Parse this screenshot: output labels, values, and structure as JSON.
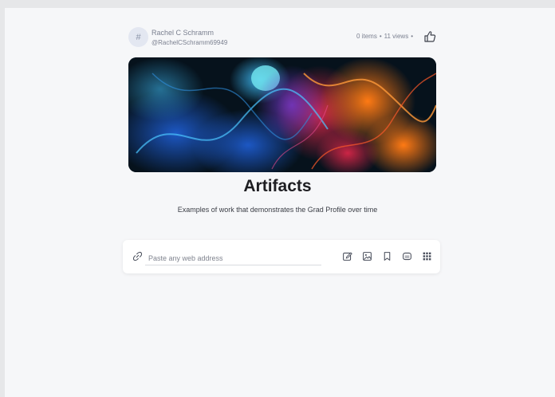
{
  "user": {
    "avatar_glyph": "#",
    "name": "Rachel C Schramm",
    "handle": "@RachelCSchramm69949"
  },
  "stats": {
    "items": "0 items",
    "views": "11 views",
    "separator": "•"
  },
  "page": {
    "title": "Artifacts",
    "subtitle": "Examples of work that demonstrates the Grad Profile over time"
  },
  "composer": {
    "placeholder": "Paste any web address",
    "value": ""
  },
  "icons": {
    "like": "thumbs-up-icon",
    "link": "link-icon",
    "tools": [
      "note-edit-icon",
      "image-icon",
      "bookmark-icon",
      "media-icon",
      "grid-icon"
    ]
  },
  "colors": {
    "background": "#f6f7f9",
    "icon": "#4a4f5c",
    "banner_blue": "#2f8fe0",
    "banner_orange": "#ff6a12"
  }
}
